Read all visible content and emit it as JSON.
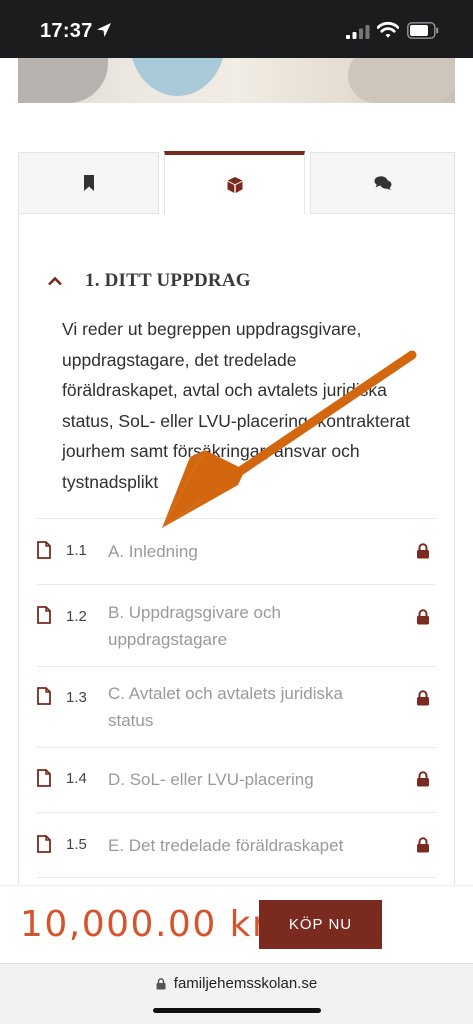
{
  "status_bar": {
    "time": "17:37",
    "icons": [
      "location-arrow-icon",
      "cellular-signal-icon",
      "wifi-icon",
      "battery-icon"
    ]
  },
  "tabs": [
    {
      "icon": "bookmark-icon",
      "active": false
    },
    {
      "icon": "cube-icon",
      "active": true
    },
    {
      "icon": "comments-icon",
      "active": false
    }
  ],
  "section": {
    "title": "1. DITT UPPDRAG",
    "description": "Vi reder ut begreppen uppdragsgivare, uppdragstagare, det tredelade föräldraskapet, avtal och avtalets juridiska status, SoL- eller LVU-placering, kontrakterat jourhem samt försäkringar, ansvar och tystnadsplikt"
  },
  "lessons": [
    {
      "number": "1.1",
      "title": "A. Inledning",
      "locked": true
    },
    {
      "number": "1.2",
      "title": "B. Uppdragsgivare och uppdragstagare",
      "locked": true
    },
    {
      "number": "1.3",
      "title": "C. Avtalet och avtalets juridiska status",
      "locked": true
    },
    {
      "number": "1.4",
      "title": "D. SoL- eller LVU-placering",
      "locked": true
    },
    {
      "number": "1.5",
      "title": "E. Det tredelade föräldraskapet",
      "locked": true
    }
  ],
  "buy_bar": {
    "price": "10,000.00 kr",
    "button_label": "KÖP NU"
  },
  "browser": {
    "url": "familjehemsskolan.se"
  },
  "colors": {
    "accent": "#7a2a1f",
    "price": "#d5542b",
    "annotation_arrow": "#d2670f"
  }
}
